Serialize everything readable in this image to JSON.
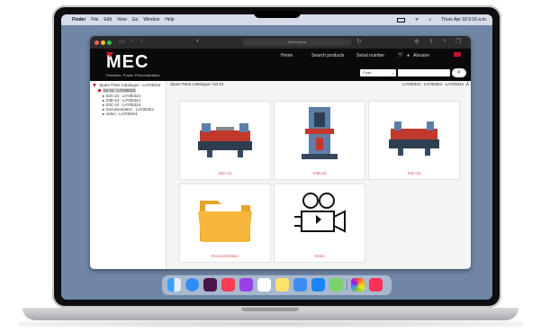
{
  "menubar": {
    "apple": "",
    "app": "Finder",
    "items": [
      "File",
      "Edit",
      "View",
      "Go",
      "Window",
      "Help"
    ],
    "clock": "Thurs Apr 18 9:16 a.m."
  },
  "browser": {
    "url": "lhotsoup.ca",
    "back": "‹",
    "forward": "›"
  },
  "site": {
    "logo": "MEC",
    "tagline": "Precision. Power. Personalization.",
    "nav": [
      "Home",
      "Search products",
      "Serial number"
    ],
    "cart": "🛒",
    "user": "Alexane",
    "search_category": "Code",
    "search_placeholder": "",
    "search_icon": "⌕"
  },
  "sidebar": {
    "root": "Spare Parts Catalogue : LAY05324",
    "selected": "53-24 : LAY05324",
    "children": [
      "S3A-24 : LAY05324",
      "S3B-24 : LAY05324",
      "S3C-24 : LAY05324",
      "Documentation : LAY05324",
      "Video : LAY05324"
    ]
  },
  "main": {
    "breadcrumb": "Spare Parts Catalogue / 53-24",
    "breadcrumb_right": "LAY05324 : LAY05324 - LAY05324",
    "cards": [
      "S3A-24",
      "S3B-24",
      "S3C-24",
      "Documentation",
      "Video"
    ]
  },
  "colors": {
    "brand_red": "#d21f2a",
    "header_bg": "#0a0a0b",
    "label_red": "#d9534f",
    "folder": "#f6b73c"
  }
}
